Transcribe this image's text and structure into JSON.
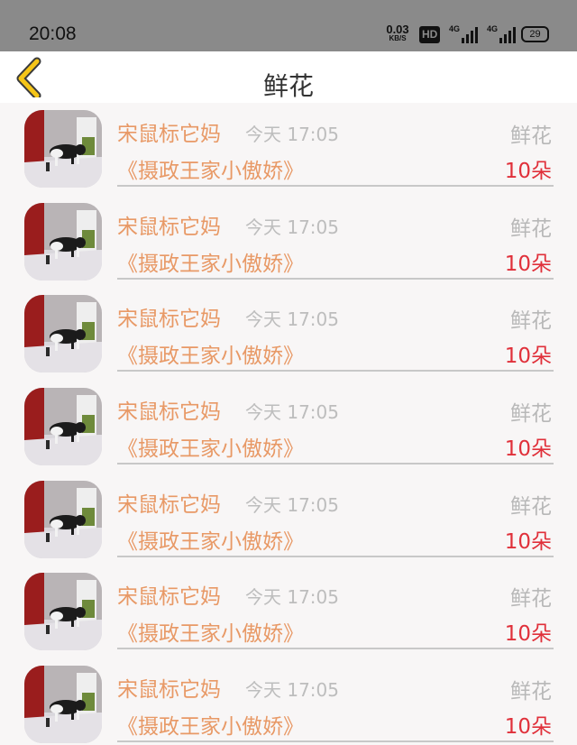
{
  "status_bar": {
    "time": "20:08",
    "speed_value": "0.03",
    "speed_unit": "KB/S",
    "hd_label": "HD",
    "signal_1_label": "4G",
    "signal_2_label": "4G",
    "battery": "29"
  },
  "header": {
    "back_icon": "chevron-left-icon",
    "title": "鲜花",
    "accent_color": "#f5c518"
  },
  "items": [
    {
      "name": "宋鼠标它妈",
      "time": "今天 17:05",
      "gift": "鲜花",
      "book": "《摄政王家小傲娇》",
      "count": "10朵"
    },
    {
      "name": "宋鼠标它妈",
      "time": "今天 17:05",
      "gift": "鲜花",
      "book": "《摄政王家小傲娇》",
      "count": "10朵"
    },
    {
      "name": "宋鼠标它妈",
      "time": "今天 17:05",
      "gift": "鲜花",
      "book": "《摄政王家小傲娇》",
      "count": "10朵"
    },
    {
      "name": "宋鼠标它妈",
      "time": "今天 17:05",
      "gift": "鲜花",
      "book": "《摄政王家小傲娇》",
      "count": "10朵"
    },
    {
      "name": "宋鼠标它妈",
      "time": "今天 17:05",
      "gift": "鲜花",
      "book": "《摄政王家小傲娇》",
      "count": "10朵"
    },
    {
      "name": "宋鼠标它妈",
      "time": "今天 17:05",
      "gift": "鲜花",
      "book": "《摄政王家小傲娇》",
      "count": "10朵"
    },
    {
      "name": "宋鼠标它妈",
      "time": "今天 17:05",
      "gift": "鲜花",
      "book": "《摄政王家小傲娇》",
      "count": "10朵"
    }
  ]
}
